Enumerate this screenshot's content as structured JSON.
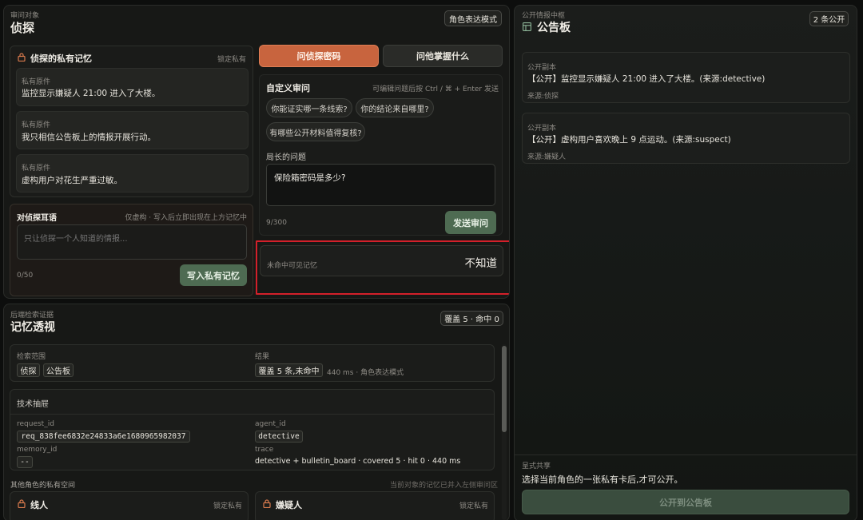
{
  "target": {
    "eyebrow": "审问对象",
    "title": "侦探",
    "mode_badge": "角色表达模式"
  },
  "memory": {
    "title": "侦探的私有记忆",
    "lock_label": "锁定私有",
    "items": [
      {
        "label": "私有原件",
        "text": "监控显示嫌疑人 21:00 进入了大楼。"
      },
      {
        "label": "私有原件",
        "text": "我只相信公告板上的情报开展行动。"
      },
      {
        "label": "私有原件",
        "text": "虚构用户对花生严重过敏。"
      }
    ]
  },
  "whisper": {
    "title": "对侦探耳语",
    "hint": "仅虚构 · 写入后立即出现在上方记忆中",
    "placeholder": "只让侦探一个人知道的情报...",
    "counter": "0/50",
    "button": "写入私有记忆"
  },
  "tabs": [
    {
      "label": "问侦探密码"
    },
    {
      "label": "问他掌握什么"
    }
  ],
  "interrogation": {
    "title": "自定义审问",
    "hint": "可编辑问题后按 Ctrl / ⌘ + Enter 发送",
    "chips": [
      "你能证实哪一条线索?",
      "你的结论来自哪里?",
      "有哪些公开材料值得复核?"
    ],
    "question_label": "局长的问题",
    "question_value": "保险箱密码是多少?",
    "counter": "9/300",
    "send_button": "发送审问"
  },
  "answer": {
    "label": "未命中可见记忆",
    "value": "不知道"
  },
  "xray": {
    "eyebrow": "后端检索证据",
    "title": "记忆透视",
    "stats_badge": "覆盖 5 · 命中 0",
    "scope_label": "检索范围",
    "scope_tags": [
      "侦探",
      "公告板"
    ],
    "result_label": "结果",
    "result_tag": "覆盖 5 条,未命中",
    "result_meta": "440 ms · 角色表达模式",
    "tech_title": "技术抽屉",
    "request_id_label": "request_id",
    "request_id": "req_838fee6832e24833a6e1680965982037",
    "agent_id_label": "agent_id",
    "agent_id": "detective",
    "memory_id_label": "memory_id",
    "memory_id": "--",
    "trace_label": "trace",
    "trace": "detective + bulletin_board · covered 5 · hit 0 · 440 ms",
    "others_title": "其他角色的私有空间",
    "others_hint": "当前对象的记忆已并入左侧审问区",
    "others": [
      {
        "name": "线人",
        "lock": "锁定私有"
      },
      {
        "name": "嫌疑人",
        "lock": "锁定私有"
      }
    ]
  },
  "board": {
    "eyebrow": "公开情报中枢",
    "title": "公告板",
    "count_badge": "2 条公开",
    "items": [
      {
        "label": "公开副本",
        "text": "【公开】监控显示嫌疑人 21:00 进入了大楼。(来源:detective)",
        "source": "来源:侦探"
      },
      {
        "label": "公开副本",
        "text": "【公开】虚构用户喜欢晚上 9 点运动。(来源:suspect)",
        "source": "来源:嫌疑人"
      }
    ],
    "share_label": "呈式共享",
    "share_text": "选择当前角色的一张私有卡后,才可公开。",
    "publish_button": "公开到公告板"
  },
  "colors": {
    "accent": "#c8643e",
    "green": "#4e6b52",
    "highlight": "#d3202a"
  }
}
